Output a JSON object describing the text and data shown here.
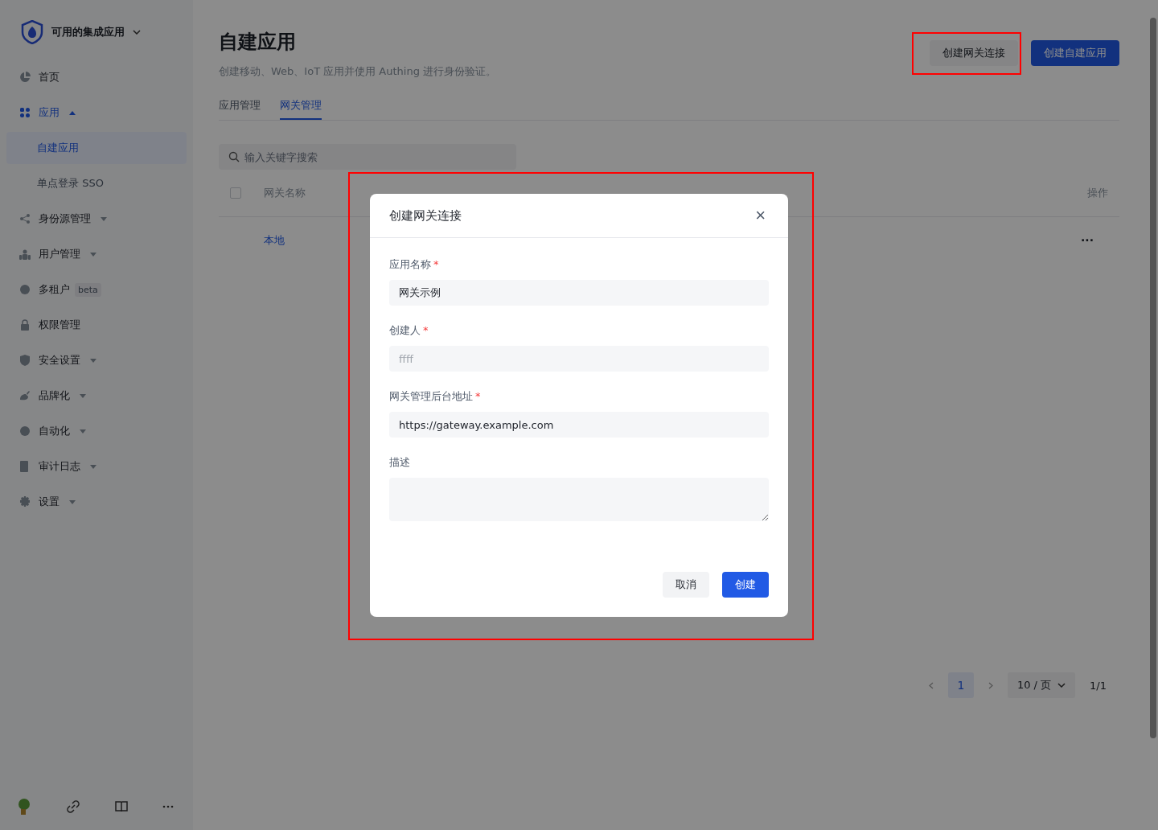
{
  "sidebar": {
    "org": "可用的集成应用",
    "items": [
      {
        "kind": "item",
        "label": "首页",
        "selected": false
      },
      {
        "kind": "group",
        "label": "应用",
        "selected": true,
        "expanded": true,
        "children": [
          {
            "label": "自建应用",
            "selected": true
          },
          {
            "label": "单点登录 SSO",
            "selected": false
          }
        ]
      },
      {
        "kind": "group",
        "label": "身份源管理",
        "selected": false,
        "expanded": false
      },
      {
        "kind": "group",
        "label": "用户管理",
        "selected": false,
        "expanded": false
      },
      {
        "kind": "item",
        "label": "多租户",
        "badge": "beta",
        "selected": false
      },
      {
        "kind": "item",
        "label": "权限管理",
        "selected": false
      },
      {
        "kind": "group",
        "label": "安全设置",
        "selected": false,
        "expanded": false
      },
      {
        "kind": "group",
        "label": "品牌化",
        "selected": false,
        "expanded": false
      },
      {
        "kind": "group",
        "label": "自动化",
        "selected": false,
        "expanded": false
      },
      {
        "kind": "group",
        "label": "审计日志",
        "selected": false,
        "expanded": false
      },
      {
        "kind": "group",
        "label": "设置",
        "selected": false,
        "expanded": false
      }
    ]
  },
  "header": {
    "title": "自建应用",
    "subtitle": "创建移动、Web、IoT 应用并使用 Authing 进行身份验证。",
    "buttons": [
      {
        "label": "创建网关连接",
        "kind": "secondary"
      },
      {
        "label": "创建自建应用",
        "kind": "primary"
      }
    ]
  },
  "tabs": [
    {
      "label": "应用管理",
      "selected": false
    },
    {
      "label": "网关管理",
      "selected": true
    }
  ],
  "search": {
    "placeholder": "输入关键字搜索"
  },
  "table": {
    "columns": [
      "网关名称",
      "操作"
    ],
    "rows": [
      {
        "name": "本地",
        "action": "···"
      }
    ],
    "all_checked": false
  },
  "pagination": {
    "page": "1",
    "page_size": "10 / 页",
    "total": "1/1"
  },
  "dialog": {
    "title": "创建网关连接",
    "close": "×",
    "fields": [
      {
        "kind": "input",
        "label": "应用名称",
        "required_mark": "*",
        "value": "网关示例"
      },
      {
        "kind": "input",
        "label": "创建人",
        "required_mark": "*",
        "placeholder": "ffff"
      },
      {
        "kind": "input",
        "label": "网关管理后台地址",
        "required_mark": "*",
        "value": "https://gateway.example.com"
      },
      {
        "kind": "textarea",
        "label": "描述"
      }
    ],
    "buttons": [
      {
        "label": "取消",
        "kind": "secondary"
      },
      {
        "label": "创建",
        "kind": "primary"
      }
    ]
  }
}
